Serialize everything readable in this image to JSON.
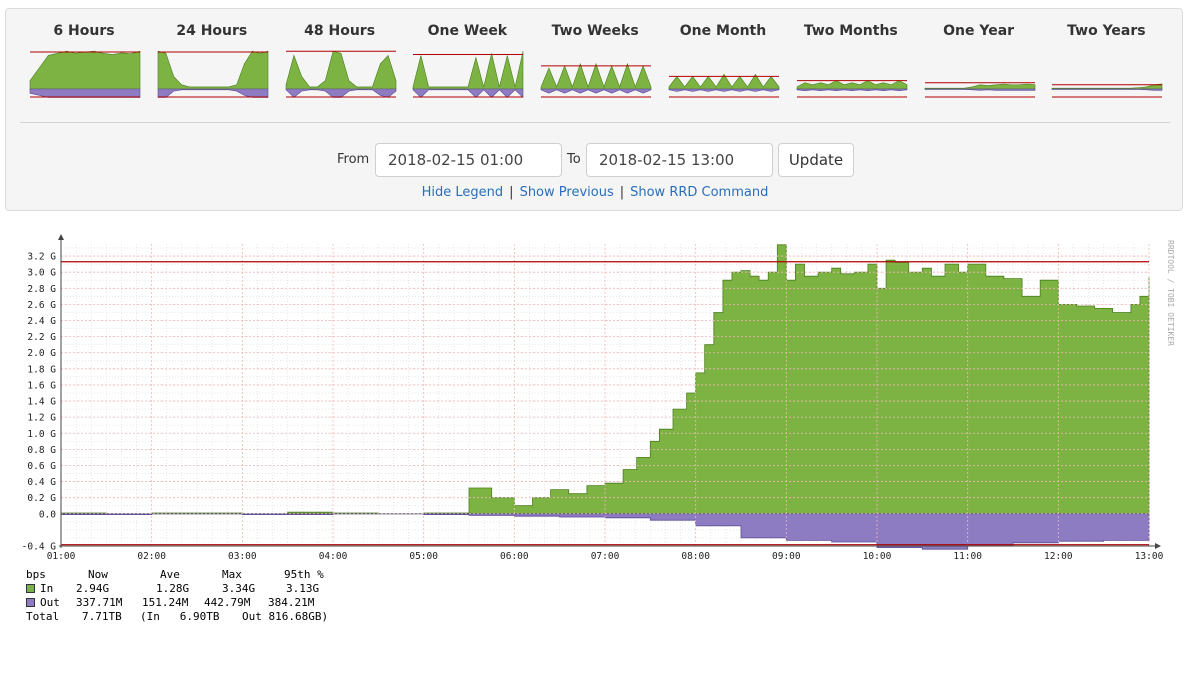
{
  "tabs": [
    {
      "label": "6 Hours"
    },
    {
      "label": "24 Hours"
    },
    {
      "label": "48 Hours"
    },
    {
      "label": "One Week"
    },
    {
      "label": "Two Weeks"
    },
    {
      "label": "One Month"
    },
    {
      "label": "Two Months"
    },
    {
      "label": "One Year"
    },
    {
      "label": "Two Years"
    }
  ],
  "form": {
    "from_label": "From",
    "from_value": "2018-02-15 01:00",
    "to_label": "To",
    "to_value": "2018-02-15 13:00",
    "update_label": "Update"
  },
  "links": {
    "hide_legend": "Hide Legend",
    "separator": "|",
    "show_previous": "Show Previous",
    "show_rrd": "Show RRD Command"
  },
  "watermark": "RRDTOOL / TOBI OETIKER",
  "colors": {
    "in": "#7cb342",
    "in_dark": "#4a7f1e",
    "out": "#8e7cc3",
    "out_dark": "#5b4a96",
    "p95": "#b00000",
    "grid": "#f0b8b8"
  },
  "legend": {
    "headers": [
      "bps",
      "Now",
      "Ave",
      "Max",
      "95th %"
    ],
    "rows": [
      {
        "name": "In",
        "now": "2.94G",
        "ave": "1.28G",
        "max": "3.34G",
        "p95": "3.13G"
      },
      {
        "name": "Out",
        "now": "337.71M",
        "ave": "151.24M",
        "max": "442.79M",
        "p95": "384.21M"
      }
    ],
    "total_label": "Total",
    "total_value": "7.71TB",
    "total_in": "(In   6.90TB",
    "total_out": "Out 816.68GB)"
  },
  "chart_data": {
    "type": "area",
    "yunit": "G",
    "ylim": [
      -0.4,
      3.35
    ],
    "yticks": [
      3.2,
      3.0,
      2.8,
      2.6,
      2.4,
      2.2,
      2.0,
      1.8,
      1.6,
      1.4,
      1.2,
      1.0,
      0.8,
      0.6,
      0.4,
      0.2,
      0.0,
      -0.4
    ],
    "ytick_labels": [
      "3.2 G",
      "3.0 G",
      "2.8 G",
      "2.6 G",
      "2.4 G",
      "2.2 G",
      "2.0 G",
      "1.8 G",
      "1.6 G",
      "1.4 G",
      "1.2 G",
      "1.0 G",
      "0.8 G",
      "0.6 G",
      "0.4 G",
      "0.2 G",
      "0.0",
      "-0.4 G"
    ],
    "xticks": [
      "01:00",
      "02:00",
      "03:00",
      "04:00",
      "05:00",
      "06:00",
      "07:00",
      "08:00",
      "09:00",
      "10:00",
      "11:00",
      "12:00",
      "13:00"
    ],
    "xlim_hours": [
      1,
      13
    ],
    "p95_in": 3.13,
    "p95_out": -0.384,
    "grid": true,
    "series": [
      {
        "name": "In",
        "x": [
          1.0,
          1.5,
          2.0,
          2.5,
          3.0,
          3.5,
          4.0,
          4.5,
          5.0,
          5.49,
          5.5,
          5.75,
          6.0,
          6.2,
          6.4,
          6.6,
          6.8,
          7.0,
          7.2,
          7.35,
          7.5,
          7.6,
          7.75,
          7.9,
          8.0,
          8.1,
          8.2,
          8.3,
          8.4,
          8.5,
          8.6,
          8.7,
          8.8,
          8.9,
          9.0,
          9.1,
          9.2,
          9.35,
          9.5,
          9.6,
          9.75,
          9.9,
          10.0,
          10.1,
          10.2,
          10.35,
          10.5,
          10.6,
          10.75,
          10.9,
          11.0,
          11.2,
          11.4,
          11.6,
          11.8,
          12.0,
          12.2,
          12.4,
          12.6,
          12.8,
          12.9,
          13.0
        ],
        "y": [
          0.01,
          0.0,
          0.01,
          0.01,
          0.0,
          0.02,
          0.01,
          0.0,
          0.01,
          0.01,
          0.32,
          0.2,
          0.1,
          0.2,
          0.3,
          0.25,
          0.35,
          0.38,
          0.55,
          0.7,
          0.9,
          1.05,
          1.3,
          1.5,
          1.75,
          2.1,
          2.5,
          2.9,
          3.0,
          3.02,
          2.95,
          2.9,
          3.0,
          3.34,
          2.9,
          3.1,
          2.95,
          3.0,
          3.05,
          2.98,
          3.0,
          3.1,
          2.8,
          3.15,
          3.12,
          3.0,
          3.05,
          2.95,
          3.1,
          3.0,
          3.1,
          2.95,
          2.92,
          2.7,
          2.9,
          2.6,
          2.58,
          2.55,
          2.5,
          2.6,
          2.7,
          2.94
        ]
      },
      {
        "name": "Out",
        "x": [
          1.0,
          2.0,
          3.0,
          4.0,
          5.0,
          5.49,
          5.5,
          6.0,
          6.5,
          7.0,
          7.5,
          8.0,
          8.5,
          9.0,
          9.5,
          10.0,
          10.5,
          11.0,
          11.5,
          12.0,
          12.5,
          13.0
        ],
        "y": [
          -0.01,
          0.0,
          -0.01,
          0.0,
          -0.01,
          -0.01,
          -0.02,
          -0.03,
          -0.04,
          -0.05,
          -0.08,
          -0.15,
          -0.3,
          -0.33,
          -0.35,
          -0.42,
          -0.44,
          -0.4,
          -0.36,
          -0.34,
          -0.33,
          -0.34
        ]
      }
    ]
  },
  "thumbs": [
    {
      "in": [
        0.2,
        0.5,
        0.8,
        0.85,
        0.9,
        0.85,
        0.88,
        0.9,
        0.85,
        0.82,
        0.86,
        0.84,
        0.9
      ],
      "out": [
        -0.1,
        -0.15,
        -0.2,
        -0.2,
        -0.2,
        -0.2,
        -0.2,
        -0.2,
        -0.2,
        -0.2,
        -0.2,
        -0.2,
        -0.2
      ],
      "p95": 0.88
    },
    {
      "in": [
        0.9,
        0.85,
        0.3,
        0.1,
        0.05,
        0.05,
        0.05,
        0.05,
        0.05,
        0.05,
        0.1,
        0.6,
        0.9,
        0.85,
        0.9
      ],
      "out": [
        -0.2,
        -0.2,
        -0.05,
        -0.02,
        -0.02,
        -0.02,
        -0.02,
        -0.02,
        -0.02,
        -0.02,
        -0.05,
        -0.15,
        -0.2,
        -0.2,
        -0.2
      ],
      "p95": 0.88
    },
    {
      "in": [
        0.1,
        0.8,
        0.3,
        0.05,
        0.05,
        0.2,
        0.9,
        0.85,
        0.2,
        0.05,
        0.05,
        0.05,
        0.6,
        0.8,
        0.2
      ],
      "out": [
        -0.02,
        -0.2,
        -0.05,
        -0.02,
        -0.02,
        -0.05,
        -0.2,
        -0.2,
        -0.05,
        -0.02,
        -0.02,
        -0.02,
        -0.15,
        -0.2,
        -0.05
      ],
      "p95": 0.9
    },
    {
      "in": [
        0.05,
        0.8,
        0.05,
        0.05,
        0.05,
        0.05,
        0.05,
        0.05,
        0.75,
        0.05,
        0.85,
        0.05,
        0.8,
        0.05,
        0.9
      ],
      "out": [
        -0.02,
        -0.2,
        -0.02,
        -0.02,
        -0.02,
        -0.02,
        -0.02,
        -0.02,
        -0.2,
        -0.02,
        -0.2,
        -0.02,
        -0.2,
        -0.02,
        -0.2
      ],
      "p95": 0.82
    },
    {
      "in": [
        0.05,
        0.5,
        0.05,
        0.55,
        0.05,
        0.6,
        0.05,
        0.6,
        0.05,
        0.55,
        0.05,
        0.6,
        0.05,
        0.55,
        0.05
      ],
      "out": [
        -0.02,
        -0.1,
        -0.02,
        -0.1,
        -0.02,
        -0.1,
        -0.02,
        -0.1,
        -0.02,
        -0.1,
        -0.02,
        -0.1,
        -0.02,
        -0.1,
        -0.02
      ],
      "p95": 0.55
    },
    {
      "in": [
        0.05,
        0.3,
        0.05,
        0.3,
        0.05,
        0.3,
        0.05,
        0.35,
        0.05,
        0.3,
        0.05,
        0.35,
        0.05,
        0.3,
        0.05
      ],
      "out": [
        -0.02,
        -0.06,
        -0.02,
        -0.06,
        -0.02,
        -0.06,
        -0.02,
        -0.06,
        -0.02,
        -0.06,
        -0.02,
        -0.06,
        -0.02,
        -0.06,
        -0.02
      ],
      "p95": 0.3
    },
    {
      "in": [
        0.05,
        0.15,
        0.1,
        0.15,
        0.1,
        0.2,
        0.1,
        0.15,
        0.1,
        0.2,
        0.1,
        0.15,
        0.1,
        0.2,
        0.1
      ],
      "out": [
        -0.02,
        -0.04,
        -0.02,
        -0.04,
        -0.02,
        -0.04,
        -0.02,
        -0.04,
        -0.02,
        -0.04,
        -0.02,
        -0.04,
        -0.02,
        -0.04,
        -0.02
      ],
      "p95": 0.2
    },
    {
      "in": [
        0.02,
        0.02,
        0.02,
        0.02,
        0.02,
        0.02,
        0.05,
        0.1,
        0.08,
        0.1,
        0.12,
        0.1,
        0.1,
        0.12,
        0.1
      ],
      "out": [
        -0.01,
        -0.01,
        -0.01,
        -0.01,
        -0.01,
        -0.01,
        -0.02,
        -0.03,
        -0.02,
        -0.03,
        -0.03,
        -0.03,
        -0.03,
        -0.03,
        -0.03
      ],
      "p95": 0.15
    },
    {
      "in": [
        0.02,
        0.02,
        0.02,
        0.02,
        0.02,
        0.02,
        0.02,
        0.02,
        0.02,
        0.02,
        0.02,
        0.03,
        0.05,
        0.1,
        0.12
      ],
      "out": [
        -0.01,
        -0.01,
        -0.01,
        -0.01,
        -0.01,
        -0.01,
        -0.01,
        -0.01,
        -0.01,
        -0.01,
        -0.01,
        -0.01,
        -0.02,
        -0.03,
        -0.03
      ],
      "p95": 0.1
    }
  ]
}
